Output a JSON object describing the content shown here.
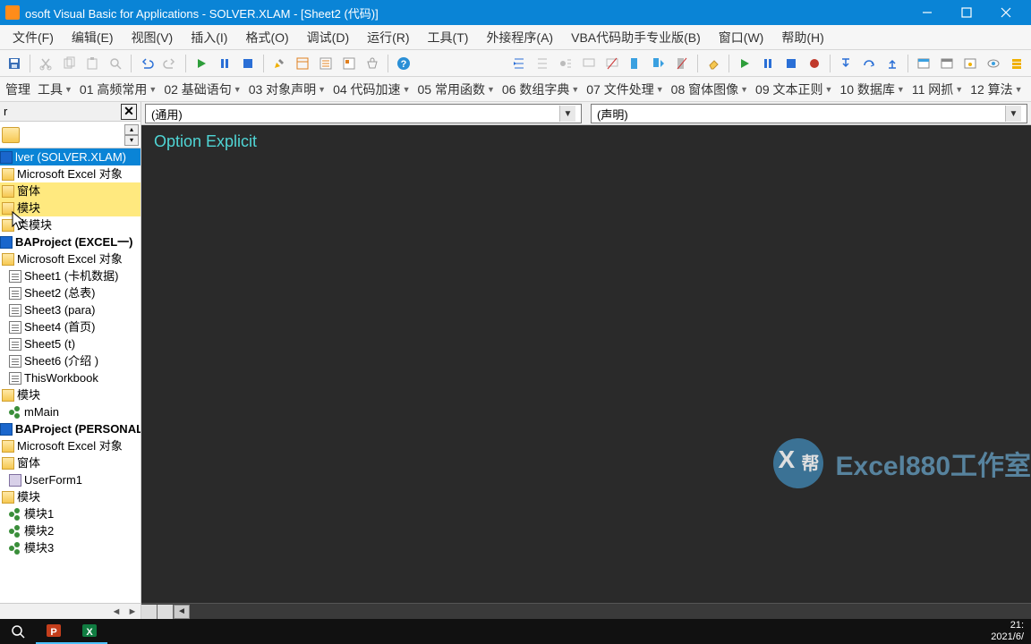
{
  "title": "osoft Visual Basic for Applications - SOLVER.XLAM - [Sheet2 (代码)]",
  "menus": [
    "文件(F)",
    "编辑(E)",
    "视图(V)",
    "插入(I)",
    "格式(O)",
    "调试(D)",
    "运行(R)",
    "工具(T)",
    "外接程序(A)",
    "VBA代码助手专业版(B)",
    "窗口(W)",
    "帮助(H)"
  ],
  "categories": [
    "管理",
    "工具",
    "01 高频常用",
    "02 基础语句",
    "03 对象声明",
    "04 代码加速",
    "05 常用函数",
    "06 数组字典",
    "07 文件处理",
    "08 窗体图像",
    "09 文本正则",
    "10 数据库",
    "11 网抓",
    "12 算法"
  ],
  "explorer": {
    "panel_label": "r",
    "nodes": [
      {
        "type": "proj",
        "label": "lver (SOLVER.XLAM)",
        "selected": true
      },
      {
        "type": "fld",
        "label": "Microsoft Excel 对象"
      },
      {
        "type": "fld",
        "label": "窗体",
        "highlight": true
      },
      {
        "type": "fld",
        "label": "模块",
        "highlight": true
      },
      {
        "type": "fld",
        "label": "类模块"
      },
      {
        "type": "proj",
        "label": "BAProject (EXCEL一)",
        "bold": true
      },
      {
        "type": "fld",
        "label": "Microsoft Excel 对象"
      },
      {
        "type": "sheet",
        "label": "Sheet1 (卡机数据)"
      },
      {
        "type": "sheet",
        "label": "Sheet2 (总表)"
      },
      {
        "type": "sheet",
        "label": "Sheet3 (para)"
      },
      {
        "type": "sheet",
        "label": "Sheet4 (首页)"
      },
      {
        "type": "sheet",
        "label": "Sheet5 (t)"
      },
      {
        "type": "sheet",
        "label": "Sheet6 (介绍 )"
      },
      {
        "type": "sheet",
        "label": "ThisWorkbook"
      },
      {
        "type": "fld",
        "label": "模块"
      },
      {
        "type": "mod",
        "label": "mMain"
      },
      {
        "type": "proj",
        "label": "BAProject (PERSONAL",
        "bold": true
      },
      {
        "type": "fld",
        "label": "Microsoft Excel 对象"
      },
      {
        "type": "fld",
        "label": "窗体"
      },
      {
        "type": "form",
        "label": "UserForm1"
      },
      {
        "type": "fld",
        "label": "模块"
      },
      {
        "type": "mod",
        "label": "模块1"
      },
      {
        "type": "mod",
        "label": "模块2"
      },
      {
        "type": "mod",
        "label": "模块3"
      }
    ]
  },
  "combos": {
    "left": "(通用)",
    "right": "(声明)"
  },
  "code": "Option Explicit",
  "watermark": "Excel880工作室",
  "taskbar": {
    "time": "21:",
    "date": "2021/6/"
  }
}
